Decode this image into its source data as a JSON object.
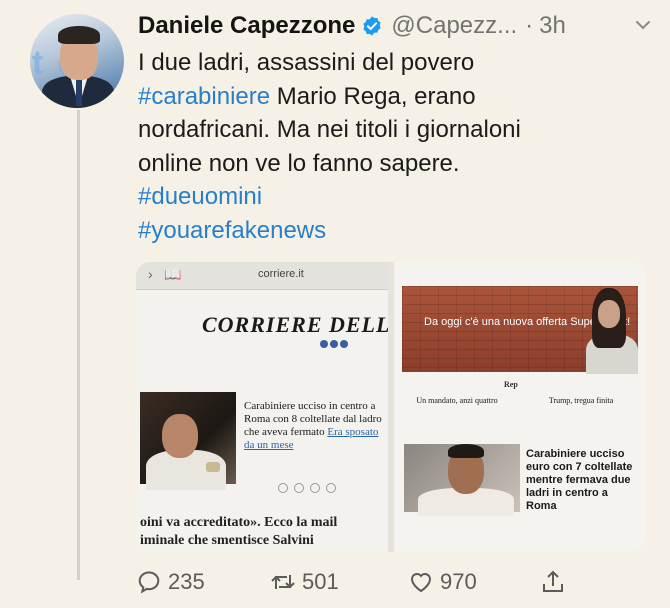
{
  "tweet": {
    "author_name": "Daniele Capezzone",
    "handle": "@Capezz...",
    "time": "3h",
    "text_lines": [
      {
        "parts": [
          {
            "t": "I due ladri, assassini del povero",
            "tag": false
          }
        ]
      },
      {
        "parts": [
          {
            "t": "#carabiniere",
            "tag": true
          },
          {
            "t": " Mario Rega, erano",
            "tag": false
          }
        ]
      },
      {
        "parts": [
          {
            "t": "nordafricani. Ma nei titoli i giornaloni",
            "tag": false
          }
        ]
      },
      {
        "parts": [
          {
            "t": "online non ve lo fanno sapere.",
            "tag": false
          }
        ]
      },
      {
        "parts": [
          {
            "t": "#dueuomini",
            "tag": true
          }
        ]
      },
      {
        "parts": [
          {
            "t": "#youarefakenews",
            "tag": true
          }
        ]
      }
    ],
    "actions": {
      "reply_count": "235",
      "retweet_count": "501",
      "like_count": "970"
    }
  },
  "media": {
    "left": {
      "url": "corriere.it",
      "masthead": "CORRIERE DELLA S",
      "headline": "Carabiniere ucciso in centro a Roma con 8 coltellate dal ladro che aveva fermato",
      "headline_link": "Era sposato da un mese",
      "quote_line1": "oini va accreditato». Ecco la mail",
      "quote_line2": "iminale che smentisce Salvini"
    },
    "right": {
      "banner_text": "Da oggi c'è una nuova offerta Supersmart!",
      "logo": "Rep",
      "col1": "Un mandato, anzi quattro",
      "col2": "Trump, tregua finita",
      "headline": "Carabiniere ucciso euro con 7 coltellate mentre fermava due ladri in centro a Roma"
    }
  },
  "colors": {
    "background": "#f6f1e6",
    "hashtag": "#2a7ec9",
    "verified": "#1d9bf0",
    "muted": "#737373"
  }
}
